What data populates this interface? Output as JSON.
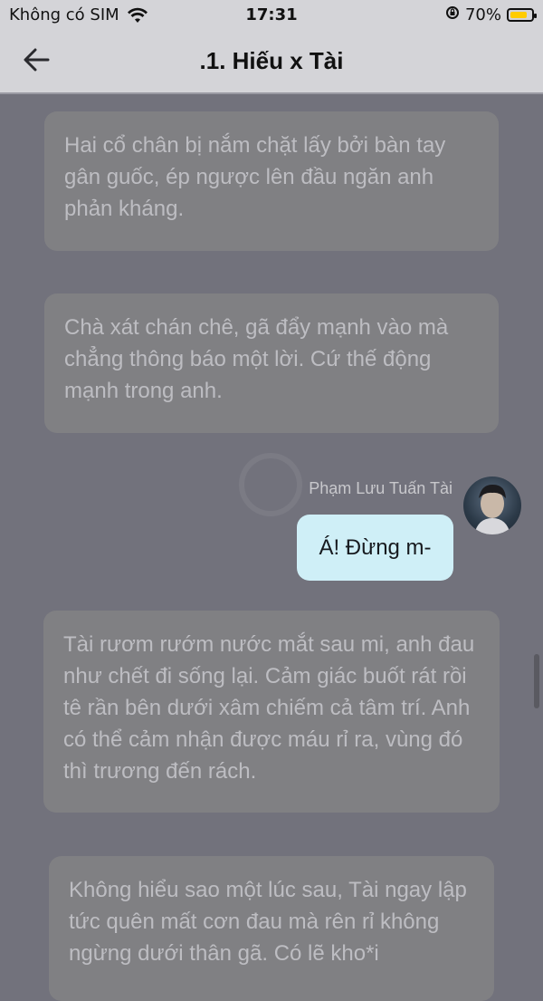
{
  "status_bar": {
    "carrier": "Không có SIM",
    "time": "17:31",
    "battery_percent": "70%",
    "battery_level": 0.7
  },
  "nav": {
    "title": ".1. Hiếu x Tài"
  },
  "messages": [
    {
      "text": "Hai cổ chân bị nắm chặt lấy bởi bàn tay gân guốc, ép ngược lên đầu ngăn anh phản kháng."
    },
    {
      "text": "Chà xát chán chê, gã đẩy mạnh vào mà chẳng thông báo một lời. Cứ thế động mạnh trong anh."
    },
    {
      "sender": "Phạm Lưu Tuấn Tài",
      "text": "Á! Đừng m-"
    },
    {
      "text": "Tài rươm rướm nước mắt sau mi, anh đau như chết đi sống lại. Cảm giác buốt rát rồi tê rần bên dưới xâm chiếm cả tâm trí. Anh có thể cảm nhận được máu rỉ ra, vùng đó thì trương đến rách."
    },
    {
      "text": "Không hiểu sao một lúc sau, Tài ngay lập tức quên mất cơn đau mà rên rỉ không ngừng dưới thân gã. Có lẽ kho*i"
    }
  ],
  "colors": {
    "background": "#72727c",
    "bar": "#d4d4d8",
    "bubble": "#808083",
    "my_bubble": "#cfeff7",
    "battery": "#ffcc00"
  }
}
